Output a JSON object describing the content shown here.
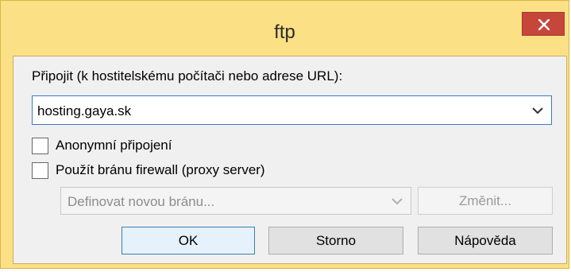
{
  "window": {
    "title": "ftp",
    "close_icon": "close-icon"
  },
  "connect": {
    "label": "Připojit (k hostitelskému počítači nebo adrese URL):",
    "host_value": "hosting.gaya.sk"
  },
  "options": {
    "anonymous_label": "Anonymní připojení",
    "anonymous_checked": false,
    "firewall_label": "Použít bránu firewall (proxy server)",
    "firewall_checked": false
  },
  "gateway": {
    "selected": "Definovat novou bránu...",
    "change_label": "Změnit..."
  },
  "buttons": {
    "ok": "OK",
    "cancel": "Storno",
    "help": "Nápověda"
  }
}
